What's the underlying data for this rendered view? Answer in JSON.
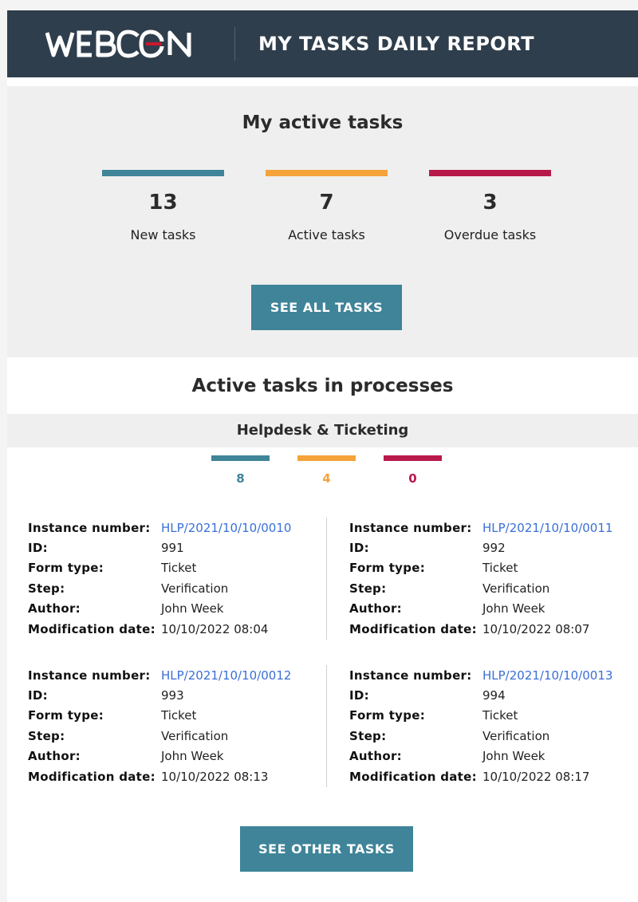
{
  "header": {
    "brand": "WEBCON",
    "title": "MY TASKS DAILY REPORT"
  },
  "summary": {
    "title": "My active tasks",
    "stats": [
      {
        "value": "13",
        "label": "New tasks",
        "color": "#3f8499"
      },
      {
        "value": "7",
        "label": "Active tasks",
        "color": "#f5a33a"
      },
      {
        "value": "3",
        "label": "Overdue tasks",
        "color": "#b8194b"
      }
    ],
    "button_label": "SEE ALL TASKS"
  },
  "processes": {
    "title": "Active tasks in processes",
    "process_name": "Helpdesk & Ticketing",
    "counts": [
      {
        "value": "8",
        "color": "#3f8499"
      },
      {
        "value": "4",
        "color": "#f5a33a"
      },
      {
        "value": "0",
        "color": "#b8194b"
      }
    ],
    "field_labels": {
      "instance": "Instance number:",
      "id": "ID:",
      "form_type": "Form type:",
      "step": "Step:",
      "author": "Author:",
      "modified": "Modification date:"
    },
    "tasks": [
      {
        "instance": "HLP/2021/10/10/0010",
        "id": "991",
        "form_type": "Ticket",
        "step": "Verification",
        "author": "John Week",
        "modified": "10/10/2022 08:04"
      },
      {
        "instance": "HLP/2021/10/10/0011",
        "id": "992",
        "form_type": "Ticket",
        "step": "Verification",
        "author": "John Week",
        "modified": "10/10/2022 08:07"
      },
      {
        "instance": "HLP/2021/10/10/0012",
        "id": "993",
        "form_type": "Ticket",
        "step": "Verification",
        "author": "John Week",
        "modified": "10/10/2022 08:13"
      },
      {
        "instance": "HLP/2021/10/10/0013",
        "id": "994",
        "form_type": "Ticket",
        "step": "Verification",
        "author": "John Week",
        "modified": "10/10/2022 08:17"
      }
    ],
    "button_label": "SEE OTHER TASKS"
  },
  "colors": {
    "header_bg": "#2f3e4c",
    "accent_teal": "#3f8499",
    "accent_orange": "#f5a33a",
    "accent_red": "#b8194b",
    "link": "#3a6fd8"
  }
}
